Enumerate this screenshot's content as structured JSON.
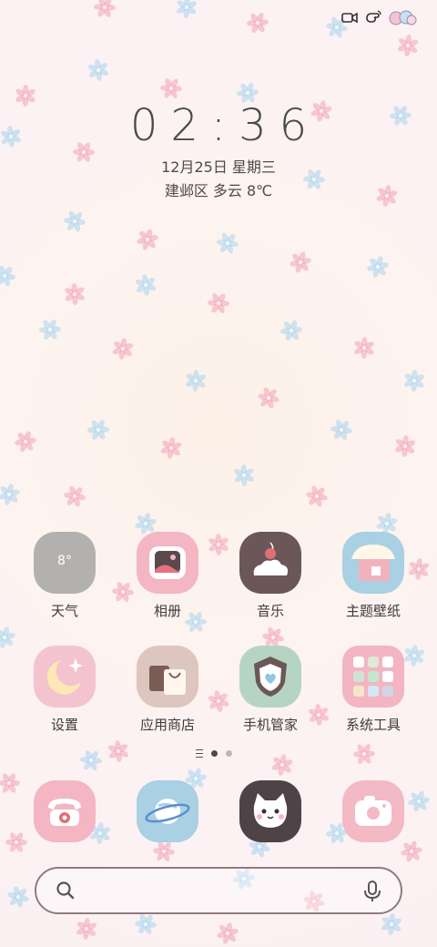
{
  "status_bar": {
    "icons": [
      "video-camera-icon",
      "hand-wave-icon",
      "clouds-sticker-icon"
    ]
  },
  "clock": {
    "time": "02:36",
    "date": "12月25日 星期三",
    "weather": "建邺区 多云 8℃"
  },
  "apps": [
    {
      "label": "天气",
      "icon": "weather-icon",
      "badge": "8°"
    },
    {
      "label": "相册",
      "icon": "photo-album-icon"
    },
    {
      "label": "音乐",
      "icon": "cake-music-icon"
    },
    {
      "label": "主题壁纸",
      "icon": "house-theme-icon"
    },
    {
      "label": "设置",
      "icon": "moon-settings-icon"
    },
    {
      "label": "应用商店",
      "icon": "shopping-bags-icon"
    },
    {
      "label": "手机管家",
      "icon": "shield-heart-icon"
    },
    {
      "label": "系统工具",
      "icon": "tools-folder-icon"
    }
  ],
  "page_indicator": {
    "pages": 2,
    "current": 1
  },
  "dock": [
    {
      "icon": "telephone-icon"
    },
    {
      "icon": "planet-browser-icon"
    },
    {
      "icon": "cat-face-icon"
    },
    {
      "icon": "camera-icon"
    }
  ],
  "search": {
    "icons": [
      "search-icon",
      "microphone-icon"
    ]
  },
  "colors": {
    "pink_flake": "#f3a3b8",
    "blue_flake": "#a9d3ec",
    "text": "#4b4a4a"
  }
}
